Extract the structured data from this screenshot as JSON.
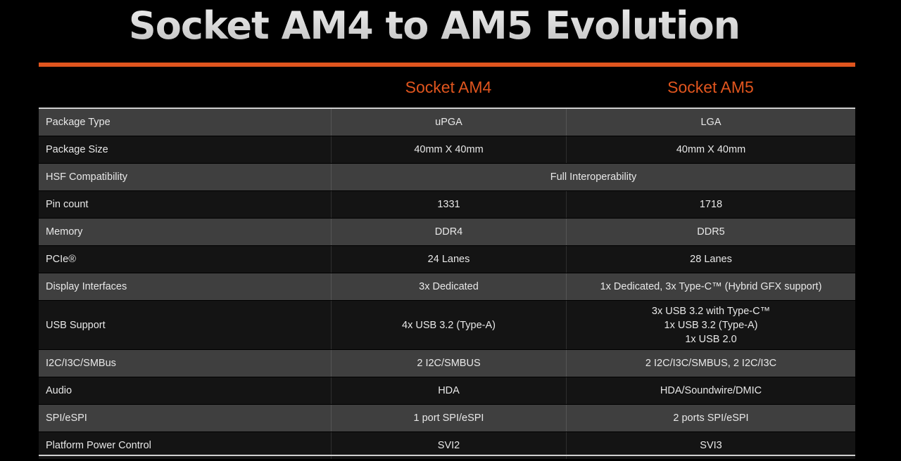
{
  "title": "Socket AM4 to AM5 Evolution",
  "columns": {
    "am4": "Socket AM4",
    "am5": "Socket AM5"
  },
  "accent_color": "#e0551e",
  "rows": [
    {
      "label": "Package Type",
      "am4": "uPGA",
      "am5": "LGA"
    },
    {
      "label": "Package Size",
      "am4": "40mm X 40mm",
      "am5": "40mm X 40mm"
    },
    {
      "label": "HSF Compatibility",
      "both": "Full Interoperability"
    },
    {
      "label": "Pin count",
      "am4": "1331",
      "am5": "1718"
    },
    {
      "label": "Memory",
      "am4": "DDR4",
      "am5": "DDR5"
    },
    {
      "label": "PCIe®",
      "am4": "24 Lanes",
      "am5": "28 Lanes"
    },
    {
      "label": "Display Interfaces",
      "am4": "3x Dedicated",
      "am5": "1x Dedicated, 3x Type-C™ (Hybrid GFX support)"
    },
    {
      "label": "USB Support",
      "am4": "4x USB 3.2 (Type-A)",
      "am5": [
        "3x USB 3.2 with Type-C™",
        "1x USB 3.2 (Type-A)",
        "1x USB 2.0"
      ]
    },
    {
      "label": "I2C/I3C/SMBus",
      "am4": "2 I2C/SMBUS",
      "am5": "2 I2C/I3C/SMBUS, 2 I2C/I3C"
    },
    {
      "label": "Audio",
      "am4": "HDA",
      "am5": "HDA/Soundwire/DMIC"
    },
    {
      "label": "SPI/eSPI",
      "am4": "1 port SPI/eSPI",
      "am5": "2 ports SPI/eSPI"
    },
    {
      "label": "Platform Power Control",
      "am4": "SVI2",
      "am5": "SVI3"
    }
  ]
}
